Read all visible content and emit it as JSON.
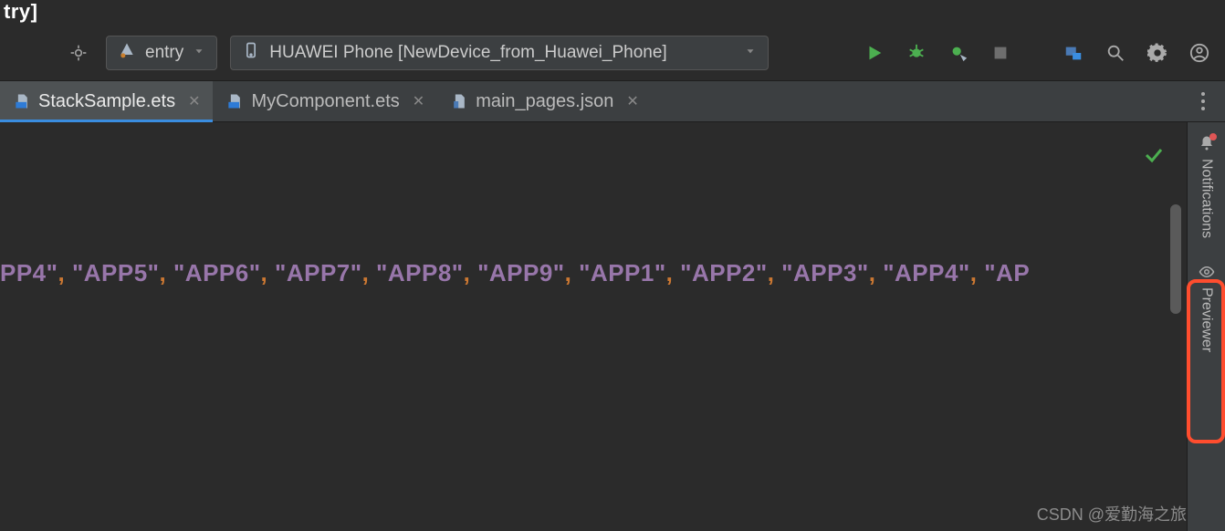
{
  "title_fragment": "try]",
  "toolbar": {
    "module_label": "entry",
    "device_label": "HUAWEI Phone [NewDevice_from_Huawei_Phone]"
  },
  "tabs": [
    {
      "label": "StackSample.ets",
      "active": true
    },
    {
      "label": "MyComponent.ets",
      "active": false
    },
    {
      "label": "main_pages.json",
      "active": false
    }
  ],
  "editor": {
    "tokens": [
      "PP4",
      "APP5",
      "APP6",
      "APP7",
      "APP8",
      "APP9",
      "APP1",
      "APP2",
      "APP3",
      "APP4",
      "AP"
    ]
  },
  "right_rail": {
    "notifications_label": "Notifications",
    "previewer_label": "Previewer"
  },
  "watermark": "CSDN @爱勤海之旅"
}
